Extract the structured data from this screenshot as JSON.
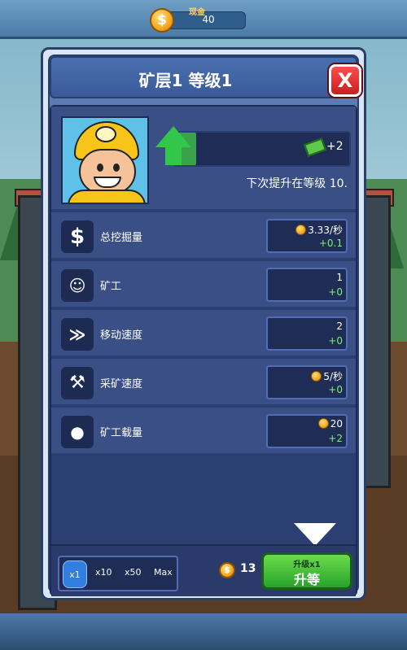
{
  "header": {
    "cash_label": "现金",
    "cash_value": "40",
    "coin_icon": "coin-icon"
  },
  "dialog": {
    "title": "矿层1 等级1",
    "close_label": "X",
    "reward": "+2",
    "next_upgrade": "下次提升在等级 10.",
    "progress": 0.12
  },
  "stats": [
    {
      "label": "总挖掘量",
      "icon": "dollar-icon",
      "value": "3.33/秒",
      "delta": "+0.1"
    },
    {
      "label": "矿工",
      "icon": "miner-icon",
      "value": "1",
      "delta": "+0"
    },
    {
      "label": "移动速度",
      "icon": "shoe-icon",
      "value": "2",
      "delta": "+0"
    },
    {
      "label": "采矿速度",
      "icon": "pickaxe-icon",
      "value": "5/秒",
      "delta": "+0"
    },
    {
      "label": "矿工载量",
      "icon": "bag-icon",
      "value": "20",
      "delta": "+2"
    }
  ],
  "footer": {
    "multipliers": [
      "x1",
      "x10",
      "x50",
      "Max"
    ],
    "cost": "13",
    "upgrade_small": "升级x1",
    "upgrade_main": "升等"
  },
  "colors": {
    "accent_green": "#32c64a",
    "panel": "#3a4f86",
    "close_red": "#e53030"
  }
}
